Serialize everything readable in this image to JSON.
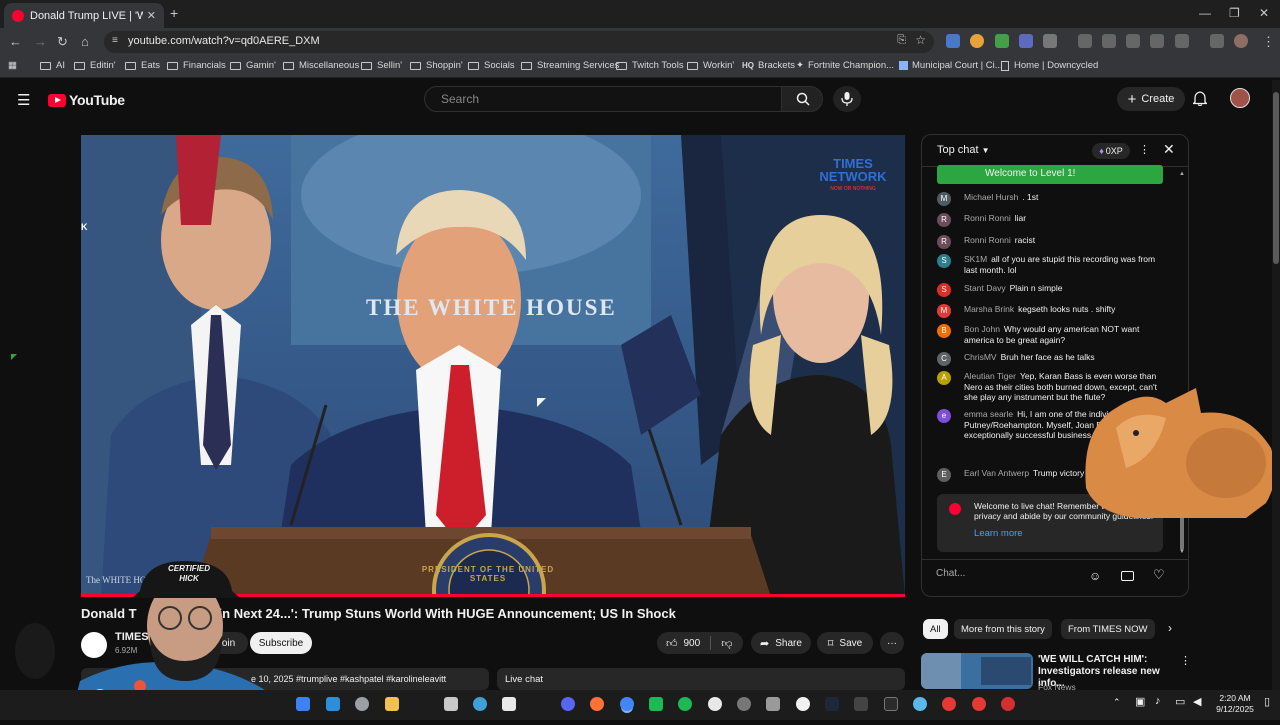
{
  "browser": {
    "tab_title": "Donald Trump LIVE | 'Withi...",
    "url": "youtube.com/watch?v=qd0AERE_DXM",
    "bookmarks": [
      "AI",
      "Editin'",
      "Eats",
      "Financials",
      "Gamin'",
      "Miscellaneous",
      "Sellin'",
      "Shoppin'",
      "Socials",
      "Streaming Services",
      "Twitch Tools",
      "Workin'",
      "Brackets",
      "Fortnite Champion...",
      "Municipal Court | Ci...",
      "Home | Downcycled"
    ]
  },
  "header": {
    "logo_text": "YouTube",
    "search_placeholder": "Search",
    "create_label": "Create"
  },
  "video": {
    "network_logo_line1": "TIMES",
    "network_logo_line2": "NETWORK",
    "network_logo_tag": "NOW OR NOTHING",
    "backdrop_text": "THE WHITE HOUSE",
    "seal_text": "PRESIDENT OF THE UNITED STATES",
    "watermark": "The WHITE HOUSE",
    "side_mark": "K",
    "progress": 1.0
  },
  "info": {
    "title_start": "Donald T",
    "title_end": "hin Next 24...': Trump Stuns World With HUGE Announcement; US In Shock",
    "channel_name": "TIMES",
    "subscribers": "6.92M",
    "join_label": "Join",
    "subscribe_label": "Subscribe",
    "like_count": "900",
    "share_label": "Share",
    "save_label": "Save",
    "description": "e 10, 2025 #trumplive #kashpatel #karolineleavitt",
    "live_chat_label": "Live chat",
    "webcam_cap_line1": "CERTIFIED",
    "webcam_cap_line2": "HICK"
  },
  "chat": {
    "mode_label": "Top chat",
    "points_label": "0XP",
    "welcome_banner": "Welcome to Level 1!",
    "messages": [
      {
        "initial": "M",
        "color": "#4f5b62",
        "author": "Michael Hursh",
        "text": ". 1st"
      },
      {
        "initial": "R",
        "color": "#6d4c5a",
        "author": "Ronni Ronni",
        "text": "liar"
      },
      {
        "initial": "R",
        "color": "#6d4c5a",
        "author": "Ronni Ronni",
        "text": "racist"
      },
      {
        "initial": "S",
        "color": "#2e7d8a",
        "author": "SK1M",
        "text": "all of you are stupid this recording was from last month. lol"
      },
      {
        "initial": "S",
        "color": "#d93025",
        "author": "Stant Davy",
        "text": "Plain n simple"
      },
      {
        "initial": "M",
        "color": "#e53935",
        "author": "Marsha Brink",
        "text": "kegseth looks nuts . shifty"
      },
      {
        "initial": "B",
        "color": "#ef6c00",
        "author": "Bon John",
        "text": "Why would any american NOT want america to be great again?"
      },
      {
        "initial": "C",
        "color": "#5f6368",
        "author": "ChrisMV",
        "text": "Bruh her face as he talks"
      },
      {
        "initial": "A",
        "color": "#b8a000",
        "author": "Aleutian Tiger",
        "text": "Yep, Karan Bass is even worse than Nero as their cities both burned down, except, can't she play any instrument but the flute?"
      },
      {
        "initial": "e",
        "color": "#7b4fd6",
        "author": "emma searle",
        "text": "Hi, I am one of the individuals from Putney/Roehampton. Myself, Joan Dowsit mum of exceptionally successful business middle aged UK"
      },
      {
        "initial": "E",
        "color": "#5f5f5f",
        "author": "Earl Van Antwerp",
        "text": "Trump victory to him Lord."
      }
    ],
    "notice_text": "Welcome to live chat! Remember to guard your privacy and abide by our community guidelines.",
    "learn_more": "Learn more",
    "input_placeholder": "Chat..."
  },
  "related": {
    "chips": [
      "All",
      "More from this story",
      "From TIMES NOW"
    ],
    "video_title": "'WE WILL CATCH HIM': Investigators release new info...",
    "video_channel": "Fox News"
  },
  "taskbar": {
    "time": "2:20 AM",
    "date": "9/12/2025"
  }
}
